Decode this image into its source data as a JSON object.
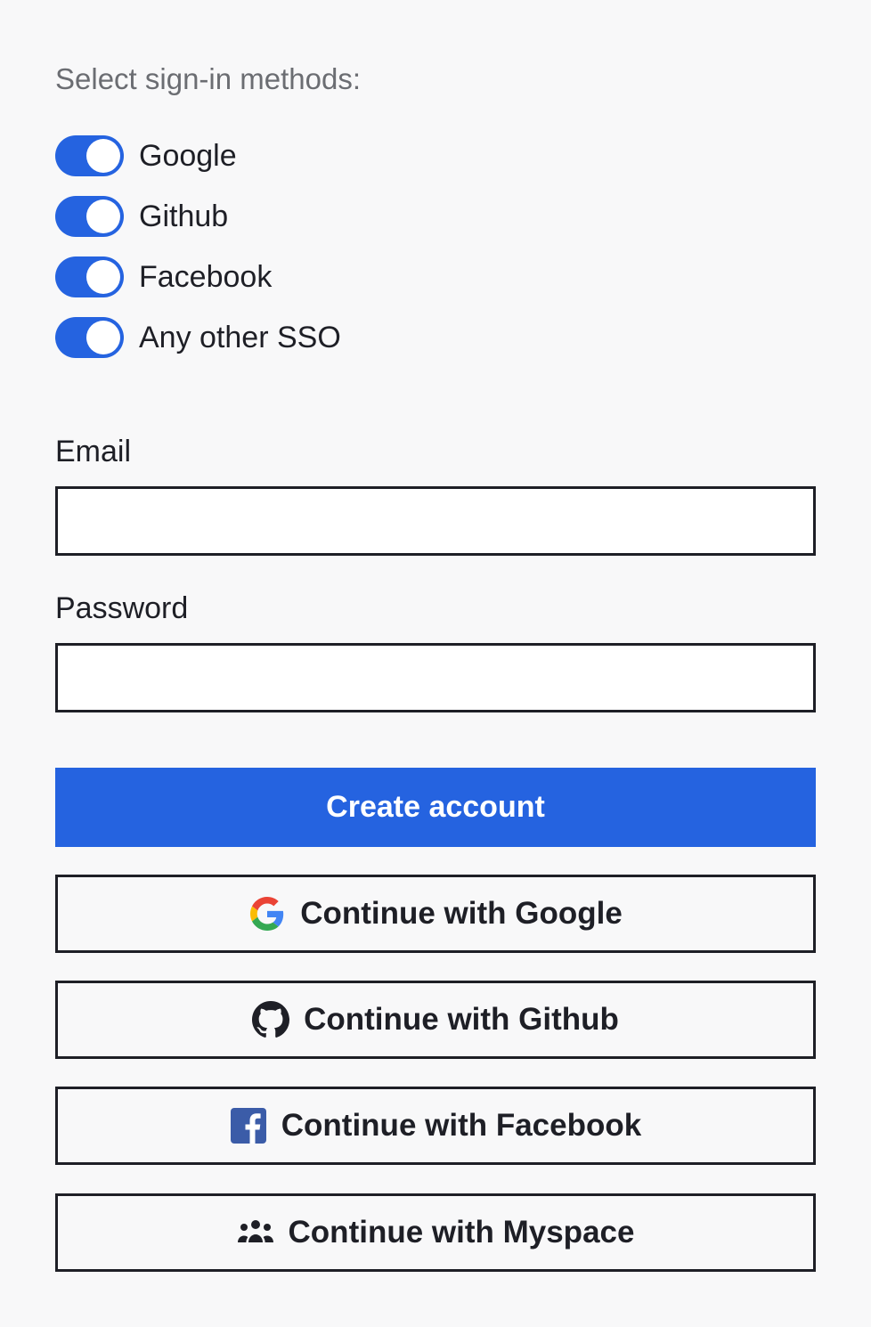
{
  "methods": {
    "title": "Select sign-in methods:",
    "options": [
      {
        "label": "Google",
        "enabled": true
      },
      {
        "label": "Github",
        "enabled": true
      },
      {
        "label": "Facebook",
        "enabled": true
      },
      {
        "label": "Any other SSO",
        "enabled": true
      }
    ]
  },
  "form": {
    "email_label": "Email",
    "email_value": "",
    "password_label": "Password",
    "password_value": ""
  },
  "actions": {
    "create_label": "Create account",
    "sso": [
      {
        "label": "Continue with Google",
        "icon": "google-icon"
      },
      {
        "label": "Continue with Github",
        "icon": "github-icon"
      },
      {
        "label": "Continue with Facebook",
        "icon": "facebook-icon"
      },
      {
        "label": "Continue with Myspace",
        "icon": "myspace-icon"
      }
    ]
  },
  "colors": {
    "accent": "#2563e0",
    "text": "#1e1f26",
    "muted": "#6b6d72",
    "background": "#f8f8f9"
  }
}
